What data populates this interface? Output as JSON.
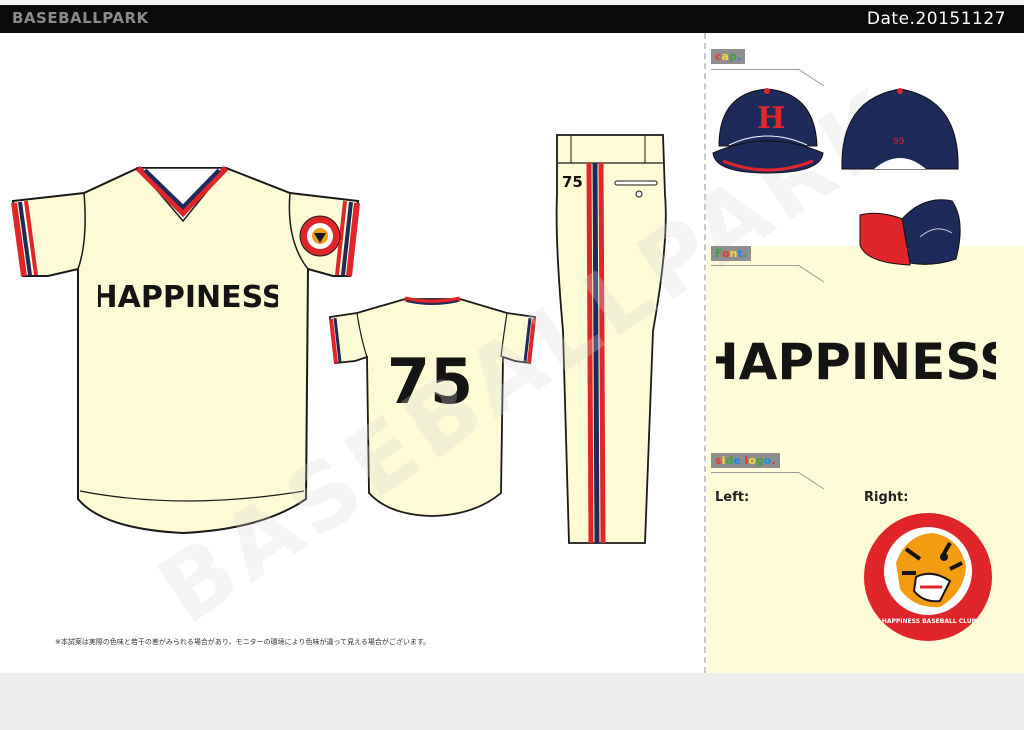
{
  "header": {
    "brand": "BASEBALLPARK",
    "date": "Date.20151127"
  },
  "jersey": {
    "front_text": "HAPPINESS",
    "back_number": "75"
  },
  "pants": {
    "number": "75"
  },
  "sections": {
    "cap": {
      "label_parts": [
        "c",
        "a",
        "p",
        "."
      ]
    },
    "font": {
      "label_parts": [
        "F",
        "o",
        "n",
        "t",
        "."
      ],
      "sample": "HAPPINESS"
    },
    "side_logo": {
      "label_parts": [
        "s",
        "i",
        "d",
        "e",
        " ",
        "l",
        "o",
        "g",
        "o",
        "."
      ]
    }
  },
  "side_logo": {
    "left_label": "Left:",
    "right_label": "Right:",
    "badge_text": "HAPPINESS BASEBALL CLUB"
  },
  "cap": {
    "front_letter": "H",
    "back_number": "99"
  },
  "watermark": "BASEBALLPARK",
  "footnote": "※本試案は実際の色味と若干の差がみられる場合があり、モニターの環境により色味が違って見える場合がございます。",
  "colors": {
    "cream": "#fdfbd6",
    "navy": "#1e2a5a",
    "red": "#e0262b",
    "black": "#141414"
  }
}
